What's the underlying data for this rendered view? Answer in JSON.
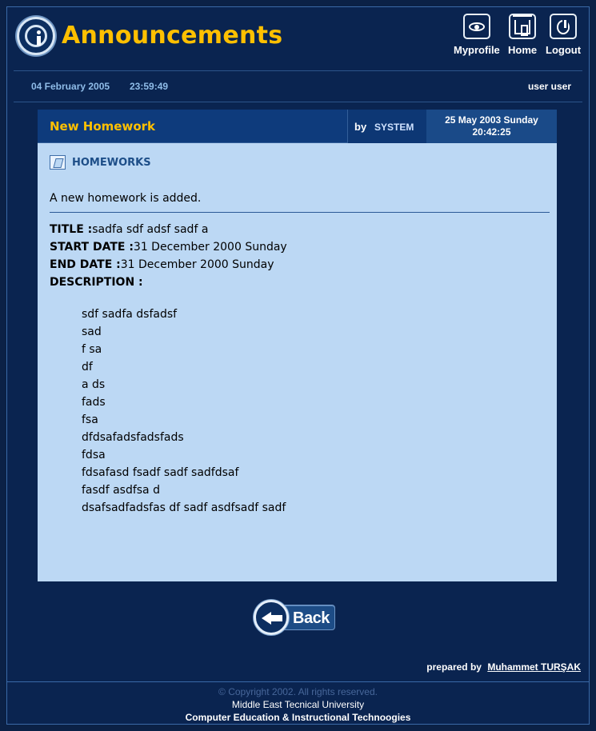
{
  "header": {
    "title": "Announcements",
    "nav": [
      {
        "label": "Myprofile",
        "icon": "eye-icon"
      },
      {
        "label": "Home",
        "icon": "house-icon"
      },
      {
        "label": "Logout",
        "icon": "power-icon"
      }
    ]
  },
  "status_bar": {
    "date": "04 February 2005",
    "time": "23:59:49",
    "user": "user user"
  },
  "announcement": {
    "title": "New Homework",
    "by_label": "by",
    "author": "SYSTEM",
    "posted_date": "25 May 2003 Sunday",
    "posted_time": "20:42:25",
    "category": "HOMEWORKS",
    "intro": "A new homework is added.",
    "fields": {
      "title_label": "TITLE :",
      "title_value": "sadfa sdf adsf sadf a",
      "start_label": "START DATE :",
      "start_value": "31 December 2000 Sunday",
      "end_label": "END DATE :",
      "end_value": "31 December 2000 Sunday",
      "description_label": "DESCRIPTION :"
    },
    "description_lines": [
      "sdf sadfa dsfadsf",
      "sad",
      "f sa",
      "df",
      "a ds",
      "fads",
      "fsa",
      "dfdsafadsfadsfads",
      "fdsa",
      "fdsafasd fsadf sadf sadfdsaf",
      "fasdf asdfsa d",
      "dsafsadfadsfas df sadf asdfsadf sadf"
    ]
  },
  "back_button": {
    "label": "Back"
  },
  "prepared_by": {
    "label": "prepared by",
    "author": "Muhammet TURŞAK"
  },
  "footer": {
    "copyright": "© Copyright 2002. All rights reserved.",
    "university": "Middle East Tecnical University",
    "department": "Computer Education & Instructional Technoogies"
  },
  "colors": {
    "background": "#0a2450",
    "accent": "#ffc000",
    "panel": "#bcd8f4",
    "date_text": "#8fbce8"
  }
}
